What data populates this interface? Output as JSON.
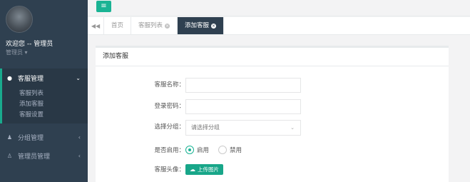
{
  "sidebar": {
    "welcome": "欢迎您 -- 管理员",
    "role": "管理员 ▾",
    "groups": [
      {
        "label": "客服管理",
        "icon": "headset-icon",
        "arrow": "⌄",
        "active": true,
        "items": [
          {
            "label": "客服列表"
          },
          {
            "label": "添加客服"
          },
          {
            "label": "客服设置"
          }
        ]
      },
      {
        "label": "分组管理",
        "icon": "users-icon",
        "arrow": "‹"
      },
      {
        "label": "管理员管理",
        "icon": "user-icon",
        "arrow": "‹"
      }
    ]
  },
  "topbar": {
    "menu_icon": "menu-icon"
  },
  "tabs": {
    "back_icon": "◀◀",
    "items": [
      {
        "label": "首页"
      },
      {
        "label": "客服列表",
        "close": "×"
      },
      {
        "label": "添加客服",
        "close": "×",
        "active": true
      }
    ]
  },
  "panel": {
    "title": "添加客服",
    "fields": {
      "name_label": "客服名称：",
      "password_label": "登录密码：",
      "group_label": "选择分组：",
      "group_placeholder": "请选择分组",
      "enable_label": "是否启用：",
      "enable_options": [
        {
          "label": "启用",
          "checked": true
        },
        {
          "label": "禁用",
          "checked": false
        }
      ],
      "avatar_label": "客服头像：",
      "upload_label": "上传图片"
    }
  },
  "colors": {
    "accent": "#1ab394",
    "sidebar": "#2f4050"
  }
}
